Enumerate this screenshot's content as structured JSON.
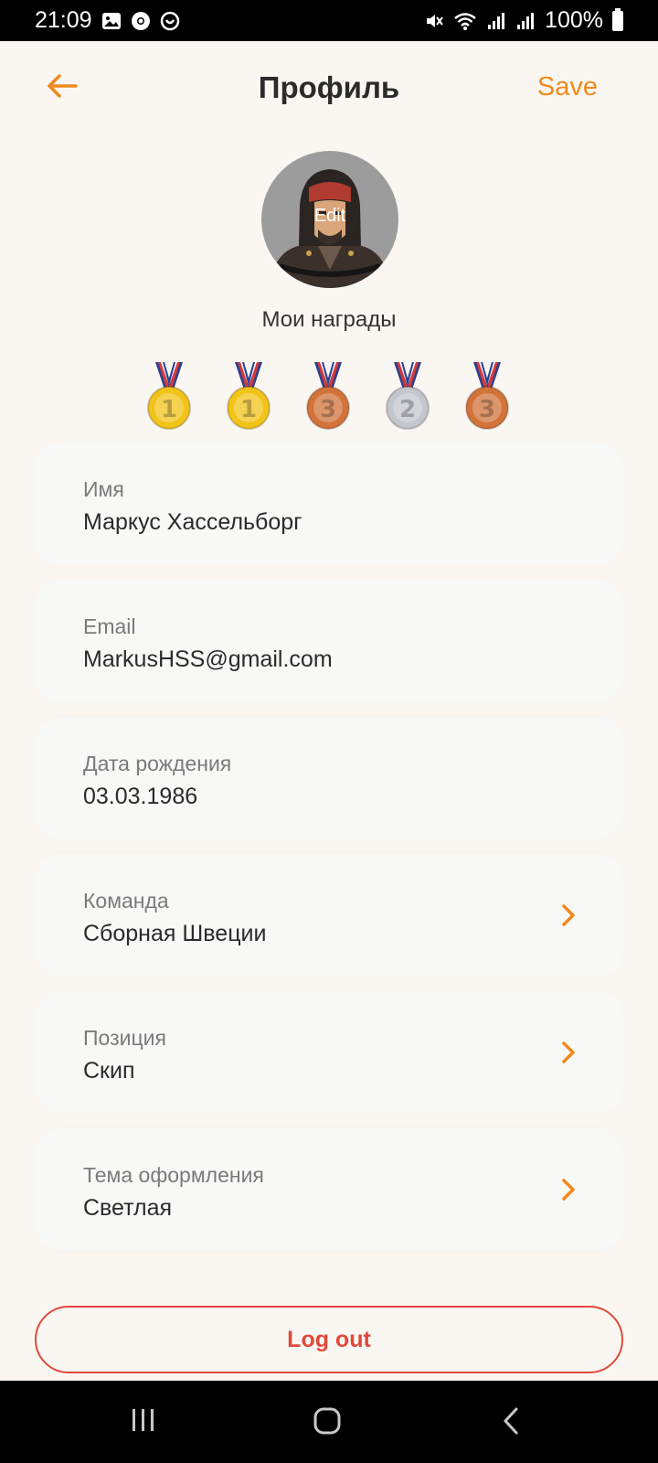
{
  "status_bar": {
    "time": "21:09",
    "battery": "100%",
    "icons": [
      "gallery-icon",
      "chrome-icon",
      "app-icon",
      "mute-icon",
      "wifi-icon",
      "signal-icon",
      "signal-icon",
      "battery-icon"
    ]
  },
  "header": {
    "title": "Профиль",
    "save_label": "Save",
    "back_icon": "arrow-left-icon"
  },
  "avatar": {
    "edit_label": "Edit"
  },
  "awards": {
    "title": "Мои награды",
    "medals": [
      {
        "place": "1",
        "color": "#f2c318"
      },
      {
        "place": "1",
        "color": "#f2c318"
      },
      {
        "place": "3",
        "color": "#d2733a"
      },
      {
        "place": "2",
        "color": "#c3c6cc"
      },
      {
        "place": "3",
        "color": "#d2733a"
      }
    ]
  },
  "fields": [
    {
      "label": "Имя",
      "value": "Маркус Хассельборг"
    },
    {
      "label": "Email",
      "value": "MarkusHSS@gmail.com"
    },
    {
      "label": "Дата рождения",
      "value": "03.03.1986"
    },
    {
      "label": "Команда",
      "value": "Сборная Швеции"
    },
    {
      "label": "Позиция",
      "value": "Скип"
    },
    {
      "label": "Тема оформления",
      "value": "Светлая"
    }
  ],
  "logout_label": "Log out",
  "colors": {
    "accent": "#f08a1e",
    "danger": "#e04a3a",
    "background": "#faf7f3",
    "card": "#f8f8f7"
  }
}
